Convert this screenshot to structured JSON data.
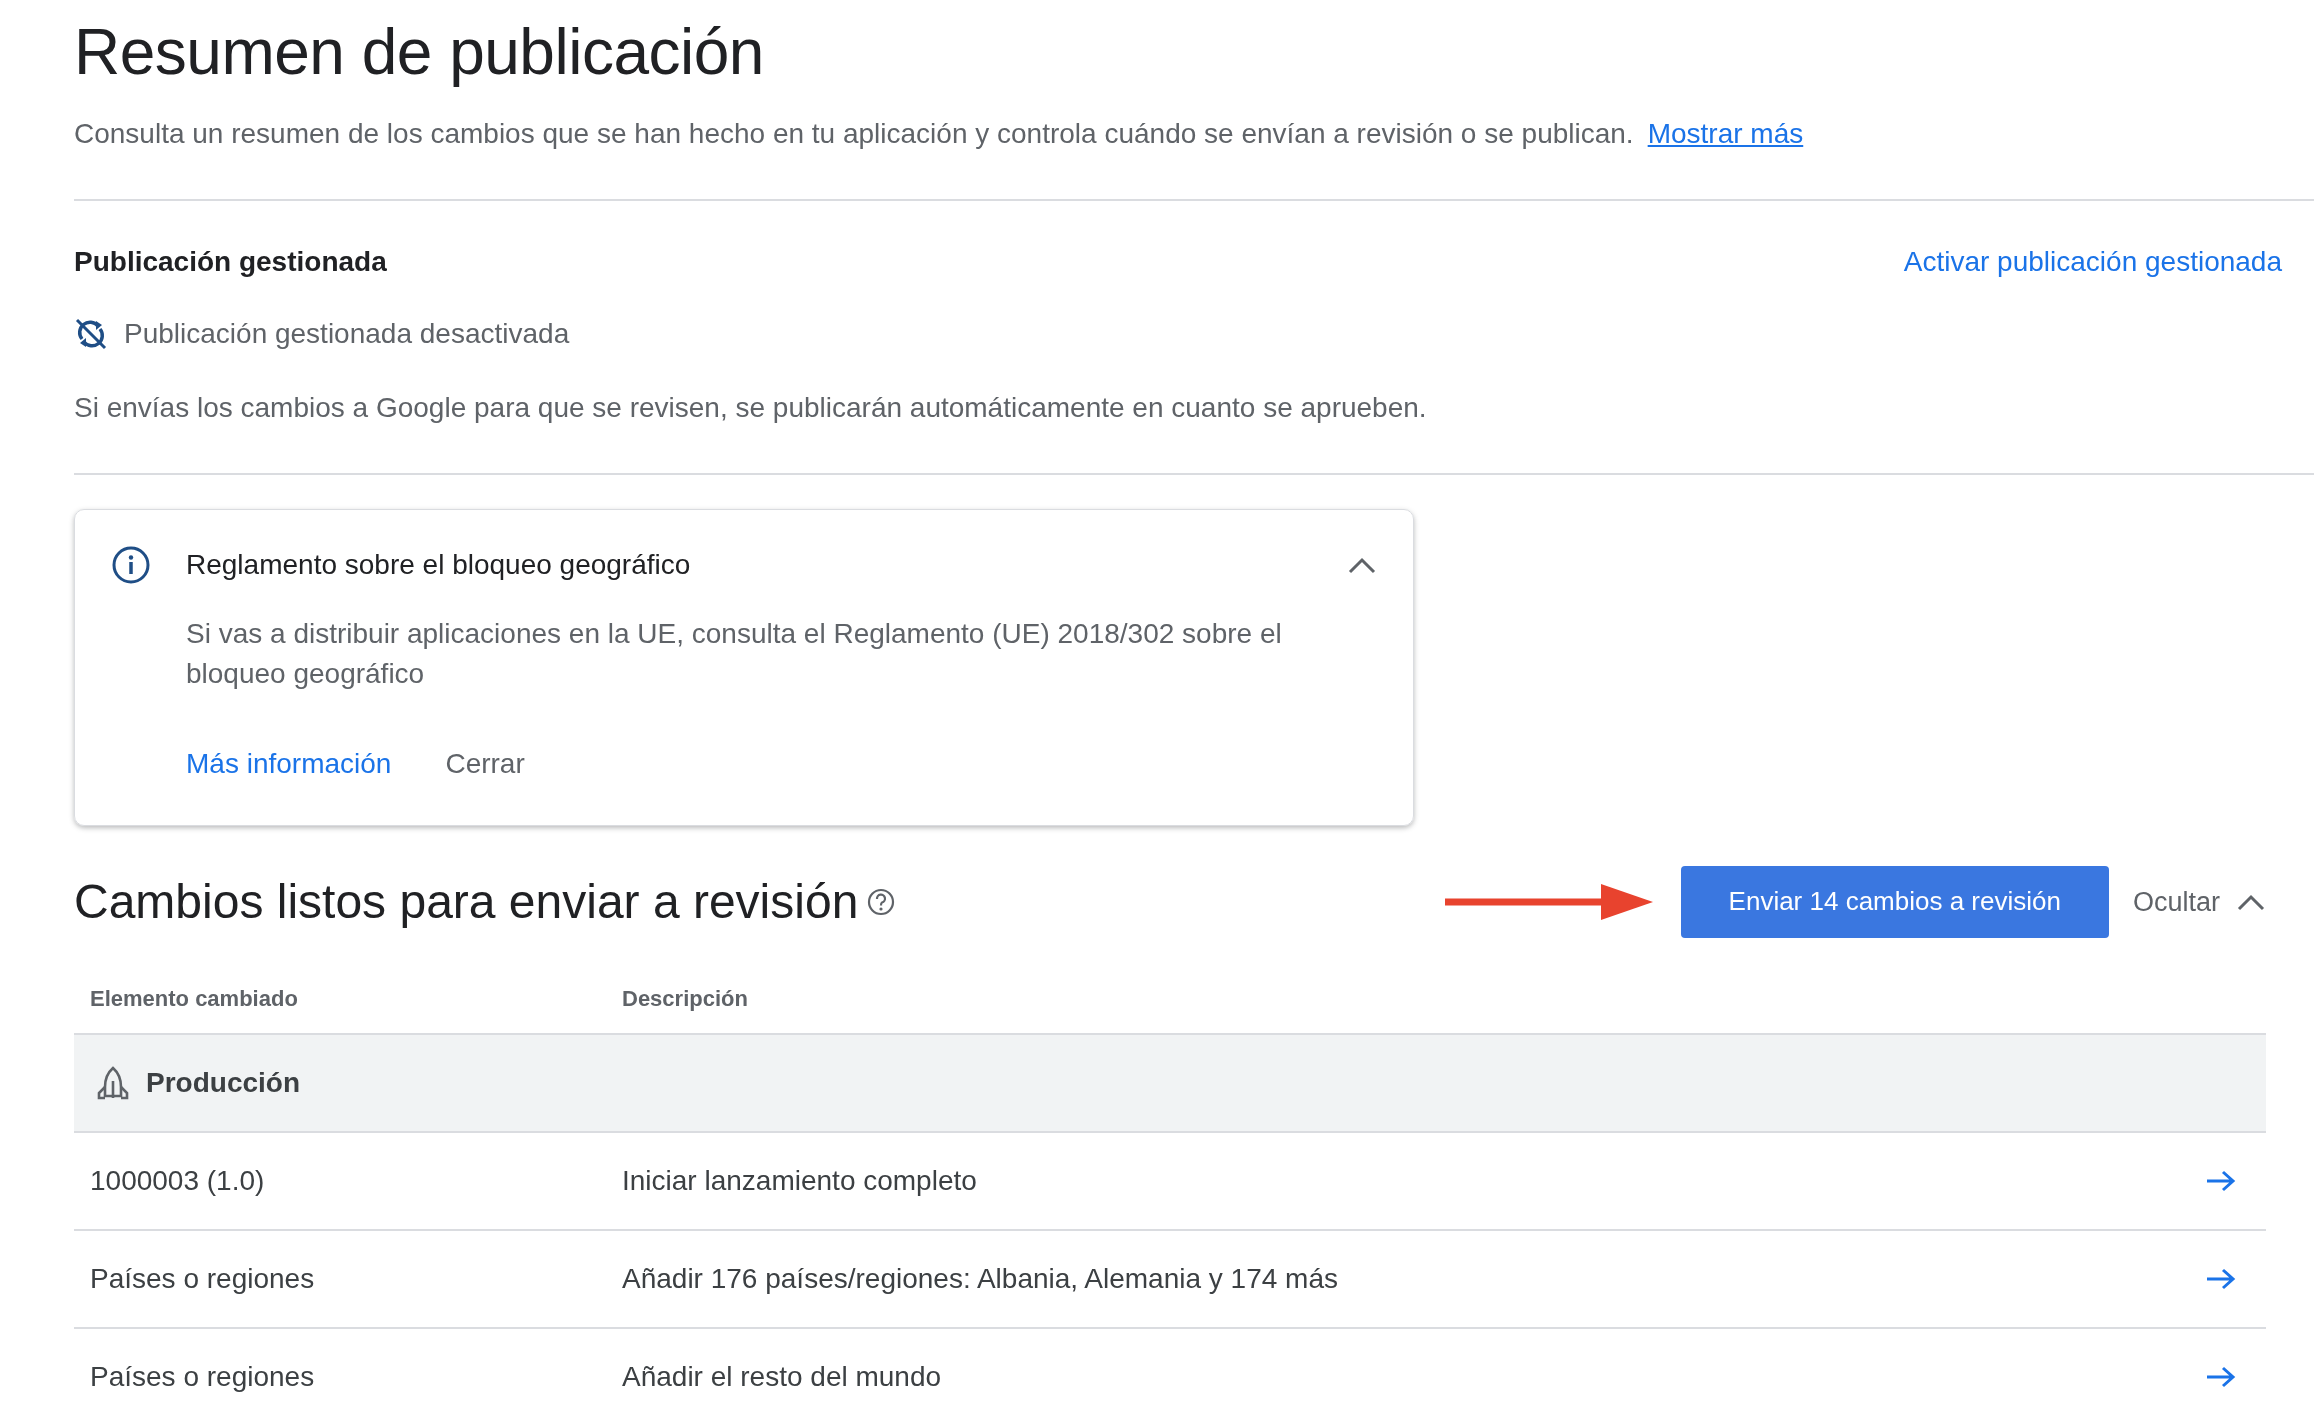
{
  "page": {
    "title": "Resumen de publicación",
    "description": "Consulta un resumen de los cambios que se han hecho en tu aplicación y controla cuándo se envían a revisión o se publican.",
    "more_link": "Mostrar más"
  },
  "managed_publishing": {
    "heading": "Publicación gestionada",
    "action": "Activar publicación gestionada",
    "status": "Publicación gestionada desactivada",
    "note": "Si envías los cambios a Google para que se revisen, se publicarán automáticamente en cuanto se aprueben."
  },
  "notice": {
    "title": "Reglamento sobre el bloqueo geográfico",
    "expanded": true,
    "body": "Si vas a distribuir aplicaciones en la UE, consulta el Reglamento (UE) 2018/302 sobre el bloqueo geográfico",
    "link": "Más información",
    "dismiss": "Cerrar"
  },
  "changes": {
    "heading": "Cambios listos para enviar a revisión",
    "submit_button": "Enviar 14 cambios a revisión",
    "toggle": {
      "label": "Ocultar",
      "expanded": true
    },
    "columns": [
      "Elemento cambiado",
      "Descripción"
    ],
    "groups": [
      {
        "name": "Producción",
        "rows": [
          {
            "item": "1000003 (1.0)",
            "description": "Iniciar lanzamiento completo"
          },
          {
            "item": "Países o regiones",
            "description": "Añadir 176 países/regiones: Albania, Alemania y 174 más"
          },
          {
            "item": "Países o regiones",
            "description": "Añadir el resto del mundo"
          }
        ]
      }
    ]
  }
}
